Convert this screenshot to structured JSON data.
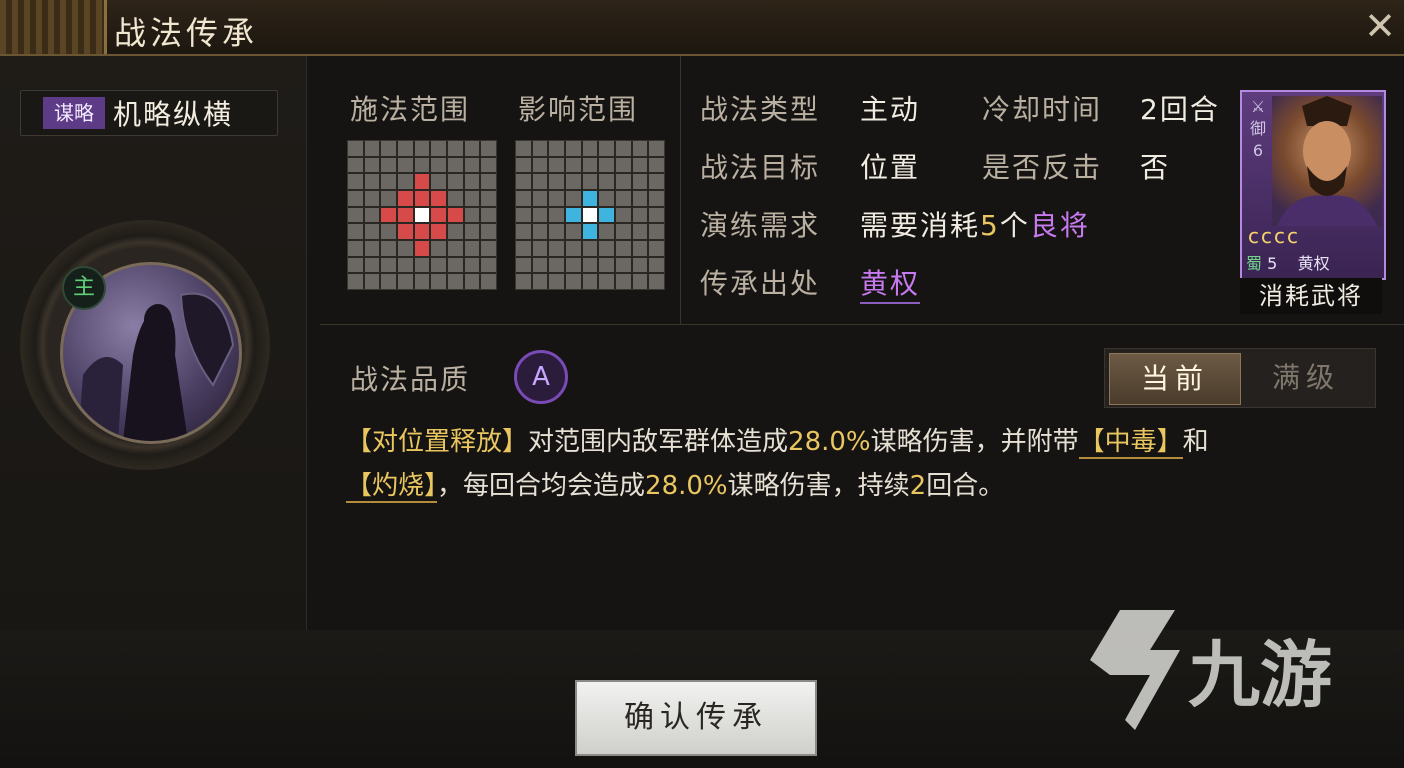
{
  "window": {
    "title": "战法传承",
    "close_icon": "close-icon"
  },
  "skill": {
    "type_tag": "谋略",
    "name": "机略纵横",
    "portrait_badge": "主"
  },
  "ranges": {
    "cast_label": "施法范围",
    "effect_label": "影响范围",
    "cast_grid": [
      [
        3,
        4,
        "red"
      ],
      [
        4,
        4,
        "red"
      ],
      [
        4,
        3,
        "red"
      ],
      [
        4,
        5,
        "red"
      ],
      [
        5,
        4,
        "red"
      ],
      [
        2,
        4,
        "red"
      ],
      [
        4,
        2,
        "red"
      ],
      [
        4,
        6,
        "red"
      ],
      [
        6,
        4,
        "red"
      ],
      [
        3,
        3,
        "red"
      ],
      [
        3,
        5,
        "red"
      ],
      [
        5,
        3,
        "red"
      ],
      [
        5,
        5,
        "red"
      ],
      [
        4,
        4,
        "white"
      ]
    ],
    "effect_grid": [
      [
        3,
        4,
        "blue"
      ],
      [
        4,
        3,
        "blue"
      ],
      [
        4,
        5,
        "blue"
      ],
      [
        5,
        4,
        "blue"
      ],
      [
        4,
        4,
        "white"
      ]
    ]
  },
  "info": {
    "type_label": "战法类型",
    "type_value": "主动",
    "cooldown_label": "冷却时间",
    "cooldown_value": "2回合",
    "target_label": "战法目标",
    "target_value": "位置",
    "counter_label": "是否反击",
    "counter_value": "否",
    "train_label": "演练需求",
    "train_value_pre": "需要消耗",
    "train_count": "5",
    "train_value_mid": "个",
    "train_grade": "良将",
    "origin_label": "传承出处",
    "origin_value": "黄权"
  },
  "general_card": {
    "stat": "御",
    "stat_value": "6",
    "faction": "蜀",
    "cost": "5",
    "name": "黄权",
    "coins": "cccc",
    "label": "消耗武将"
  },
  "quality": {
    "label": "战法品质",
    "grade": "A"
  },
  "level_toggle": {
    "current": "当前",
    "max": "满级"
  },
  "description": {
    "p1": "【对位置释放】",
    "p2": "对范围内敌军群体造成",
    "p3": "28.0%",
    "p4": "谋略伤害，并附带",
    "p5": "【中毒】",
    "p6": "和",
    "p7": "【灼烧】",
    "p8": "，每回合均会造成",
    "p9": "28.0%",
    "p10": "谋略伤害，持续",
    "p11": "2",
    "p12": "回合。"
  },
  "confirm_button": "确认传承",
  "watermark": "九游",
  "colors": {
    "accent_purple": "#5e3b86",
    "gold": "#e9c65f",
    "red_cell": "#d64a4a",
    "blue_cell": "#3fb4de",
    "grade_purple": "#b56cf0"
  }
}
